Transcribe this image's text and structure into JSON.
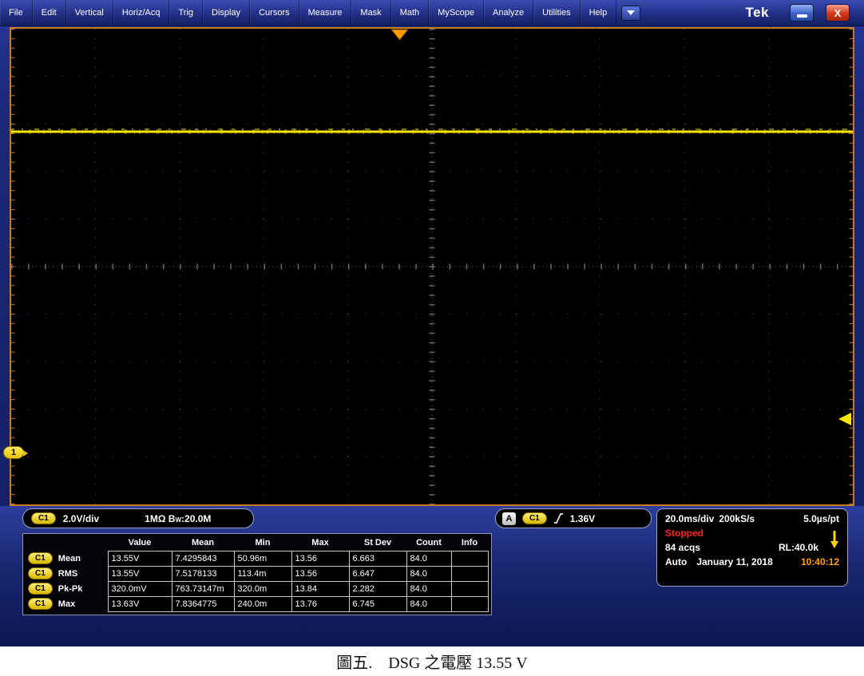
{
  "menu_bar": {
    "items": [
      "File",
      "Edit",
      "Vertical",
      "Horiz/Acq",
      "Trig",
      "Display",
      "Cursors",
      "Measure",
      "Mask",
      "Math",
      "MyScope",
      "Analyze",
      "Utilities",
      "Help"
    ],
    "logo": "Tek"
  },
  "graticule": {
    "channel_marker": "1"
  },
  "vertical_readout": {
    "channel": "C1",
    "scale": "2.0V/div",
    "impedance": "1MΩ",
    "bandwidth_b": "B",
    "bandwidth_w": "W",
    "bandwidth_value": ":20.0M"
  },
  "trigger_readout": {
    "source": "A",
    "channel": "C1",
    "level": "1.36V"
  },
  "horizontal_readout": {
    "timebase": "20.0ms/div",
    "sample_rate": "200kS/s",
    "resolution": "5.0µs/pt",
    "status": "Stopped",
    "acquisitions": "84 acqs",
    "record_length": "RL:40.0k",
    "trigger_mode": "Auto",
    "date": "January 11, 2018",
    "time": "10:40:12"
  },
  "measurements": {
    "columns": [
      "Value",
      "Mean",
      "Min",
      "Max",
      "St Dev",
      "Count",
      "Info"
    ],
    "rows": [
      {
        "channel": "C1",
        "label": "Mean",
        "value": "13.55V",
        "mean": "7.4295843",
        "min": "50.96m",
        "max": "13.56",
        "stdev": "6.663",
        "count": "84.0",
        "info": ""
      },
      {
        "channel": "C1",
        "label": "RMS",
        "value": "13.55V",
        "mean": "7.5178133",
        "min": "113.4m",
        "max": "13.56",
        "stdev": "6.647",
        "count": "84.0",
        "info": ""
      },
      {
        "channel": "C1",
        "label": "Pk-Pk",
        "value": "320.0mV",
        "mean": "763.73147m",
        "min": "320.0m",
        "max": "13.84",
        "stdev": "2.282",
        "count": "84.0",
        "info": ""
      },
      {
        "channel": "C1",
        "label": "Max",
        "value": "13.63V",
        "mean": "7.8364775",
        "min": "240.0m",
        "max": "13.76",
        "stdev": "6.745",
        "count": "84.0",
        "info": ""
      }
    ]
  },
  "caption": "圖五.　DSG 之電壓 13.55 V",
  "colors": {
    "channel1": "#ffe600",
    "status_stopped": "#ff2020",
    "time_highlight": "#ffa200",
    "graticule_border": "#c87a1e"
  },
  "chart_data": {
    "type": "line",
    "title": "Oscilloscope channel 1 trace",
    "description": "Flat DC trace at ~13.55 V (2.0 V/div, 20.0 ms/div)",
    "volts_per_div": 2.0,
    "trace_level_v": 13.55,
    "trigger_level_v": 1.36
  }
}
